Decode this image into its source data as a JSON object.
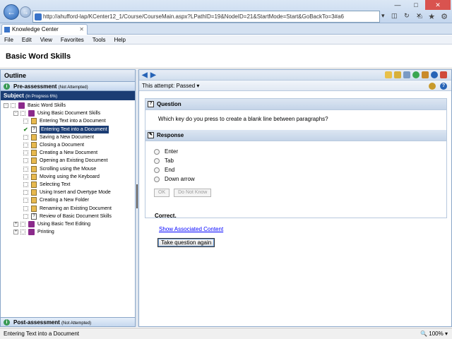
{
  "browser": {
    "url": "http://ahufford-lap/KCenter12_1/Course/CourseMain.aspx?LPathID=19&NodeID=21&StartMode=Start&GoBackTo=3#a6",
    "tab_title": "Knowledge Center",
    "menu": [
      "File",
      "Edit",
      "View",
      "Favorites",
      "Tools",
      "Help"
    ],
    "status_text": "Entering Text into a Document",
    "zoom": "100%"
  },
  "app": {
    "title": "Basic Word Skills"
  },
  "outline": {
    "title": "Outline",
    "pre_assessment": "Pre-assessment",
    "pre_assessment_status": "(Not Attempted)",
    "subject": "Subject",
    "subject_progress": "(In Progress 6%)",
    "post_assessment": "Post-assessment",
    "post_assessment_status": "(Not Attempted)",
    "tree": [
      {
        "label": "Basic Word Skills",
        "level": 0,
        "kind": "book",
        "expander": "-"
      },
      {
        "label": "Using Basic Document Skills",
        "level": 1,
        "kind": "book",
        "expander": "-"
      },
      {
        "label": "Entering Text into a Document",
        "level": 2,
        "kind": "doc",
        "status": "todo"
      },
      {
        "label": "Entering Text into a Document",
        "level": 2,
        "kind": "question",
        "status": "passed",
        "selected": true
      },
      {
        "label": "Saving a New Document",
        "level": 2,
        "kind": "doc",
        "status": "todo"
      },
      {
        "label": "Closing a Document",
        "level": 2,
        "kind": "doc",
        "status": "todo"
      },
      {
        "label": "Creating a New Document",
        "level": 2,
        "kind": "doc",
        "status": "todo"
      },
      {
        "label": "Opening an Existing Document",
        "level": 2,
        "kind": "doc",
        "status": "todo"
      },
      {
        "label": "Scrolling using the Mouse",
        "level": 2,
        "kind": "doc",
        "status": "todo"
      },
      {
        "label": "Moving using the Keyboard",
        "level": 2,
        "kind": "doc",
        "status": "todo"
      },
      {
        "label": "Selecting Text",
        "level": 2,
        "kind": "doc",
        "status": "todo"
      },
      {
        "label": "Using Insert and Overtype Mode",
        "level": 2,
        "kind": "doc",
        "status": "todo"
      },
      {
        "label": "Creating a New Folder",
        "level": 2,
        "kind": "doc",
        "status": "todo"
      },
      {
        "label": "Renaming an Existing Document",
        "level": 2,
        "kind": "doc",
        "status": "todo"
      },
      {
        "label": "Review of Basic Document Skills",
        "level": 2,
        "kind": "question",
        "status": "todo"
      },
      {
        "label": "Using Basic Text Editing",
        "level": 1,
        "kind": "book",
        "expander": "+"
      },
      {
        "label": "Printing",
        "level": 1,
        "kind": "book",
        "expander": "+"
      }
    ]
  },
  "content": {
    "attempt_label": "This attempt:",
    "attempt_value": "Passed",
    "question_heading": "Question",
    "question_text": "Which key do you press to create a blank line between paragraphs?",
    "response_heading": "Response",
    "options": [
      "Enter",
      "Tab",
      "End",
      "Down arrow"
    ],
    "ok_label": "OK",
    "do_not_know_label": "Do Not Know",
    "feedback": "Correct.",
    "assoc_link": "Show Associated Content",
    "retry_label": "Take question again"
  }
}
